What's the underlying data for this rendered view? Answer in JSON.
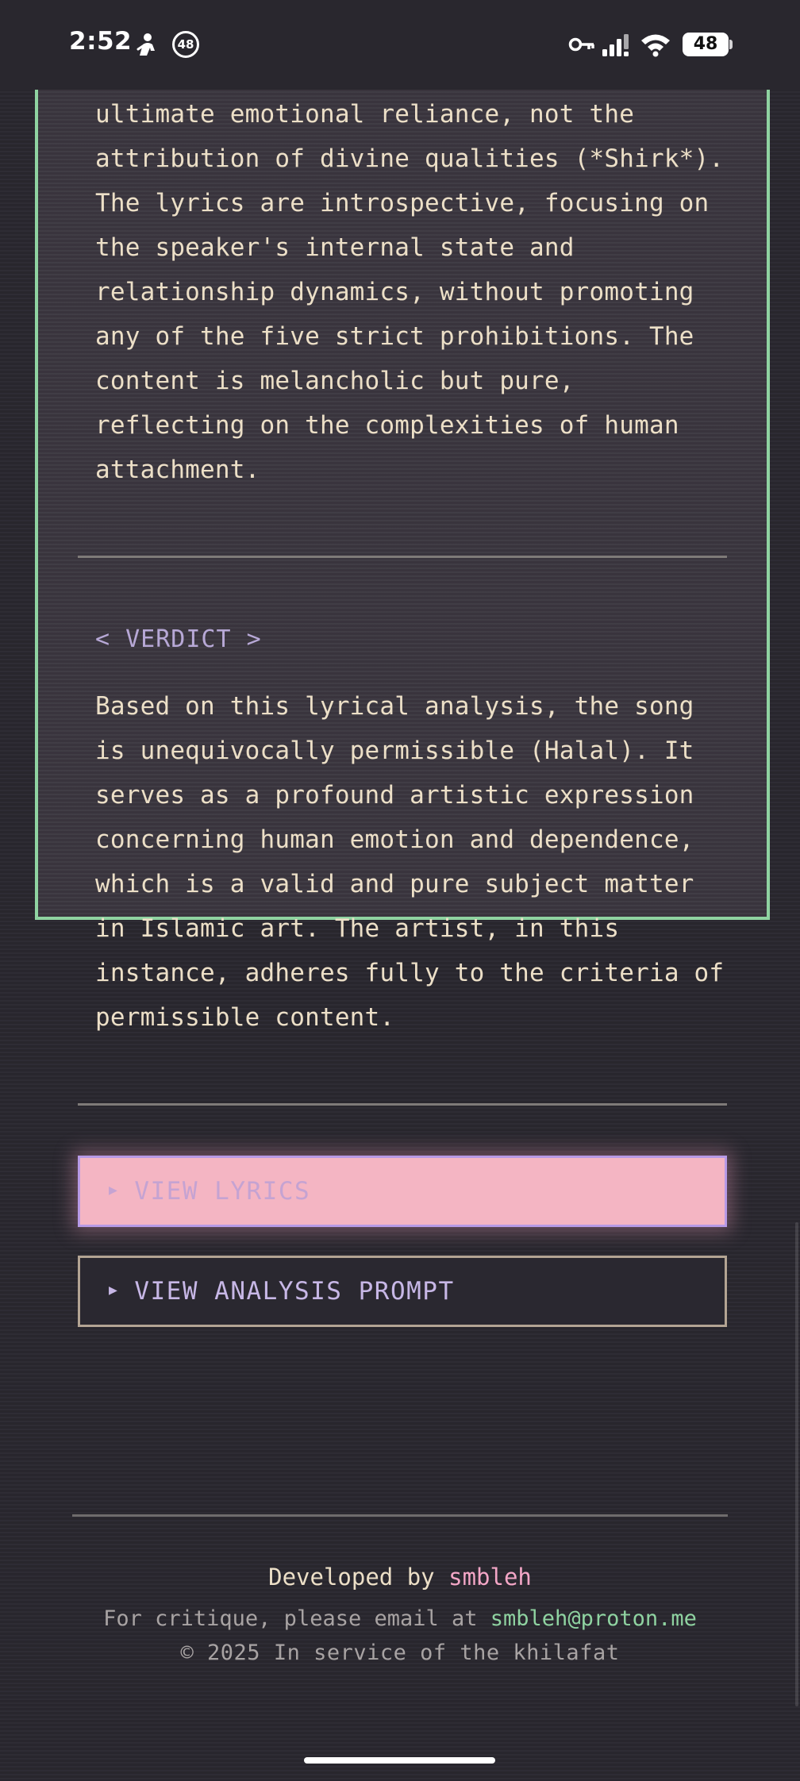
{
  "status_bar": {
    "time": "2:52",
    "notification_badge": "48",
    "battery_level": "48",
    "icons": [
      "person-icon",
      "notification-count-icon",
      "vpn-key-icon",
      "cell-signal-icon",
      "wifi-icon",
      "battery-icon"
    ]
  },
  "analysis": {
    "text": "ultimate emotional reliance, not the attribution of divine qualities (*Shirk*). The lyrics are introspective, focusing on the speaker's internal state and relationship dynamics, without promoting any of the five strict prohibitions. The content is melancholic but pure, reflecting on the complexities of human attachment."
  },
  "verdict": {
    "heading": "< VERDICT >",
    "text": "Based on this lyrical analysis, the song is unequivocally permissible (Halal). It serves as a profound artistic expression concerning human emotion and dependence, which is a valid and pure subject matter in Islamic art. The artist, in this instance, adheres fully to the criteria of permissible content."
  },
  "buttons": {
    "view_lyrics": "VIEW LYRICS",
    "view_prompt": "VIEW ANALYSIS PROMPT",
    "caret": "▶"
  },
  "footer": {
    "developed_by": "Developed by",
    "author": "smbleh",
    "critique_text": "For critique, please email at",
    "email": "smbleh@proton.me",
    "copyright": "© 2025 In service of the khilafat"
  },
  "colors": {
    "background": "#2a2830",
    "card_border": "#8fd3a1",
    "body_text": "#ecdfc7",
    "heading_lavender": "#b7a8d6",
    "lyrics_button_bg": "#f4b5c3",
    "author_pink": "#f3a6c6",
    "email_green": "#8fd3a1"
  }
}
